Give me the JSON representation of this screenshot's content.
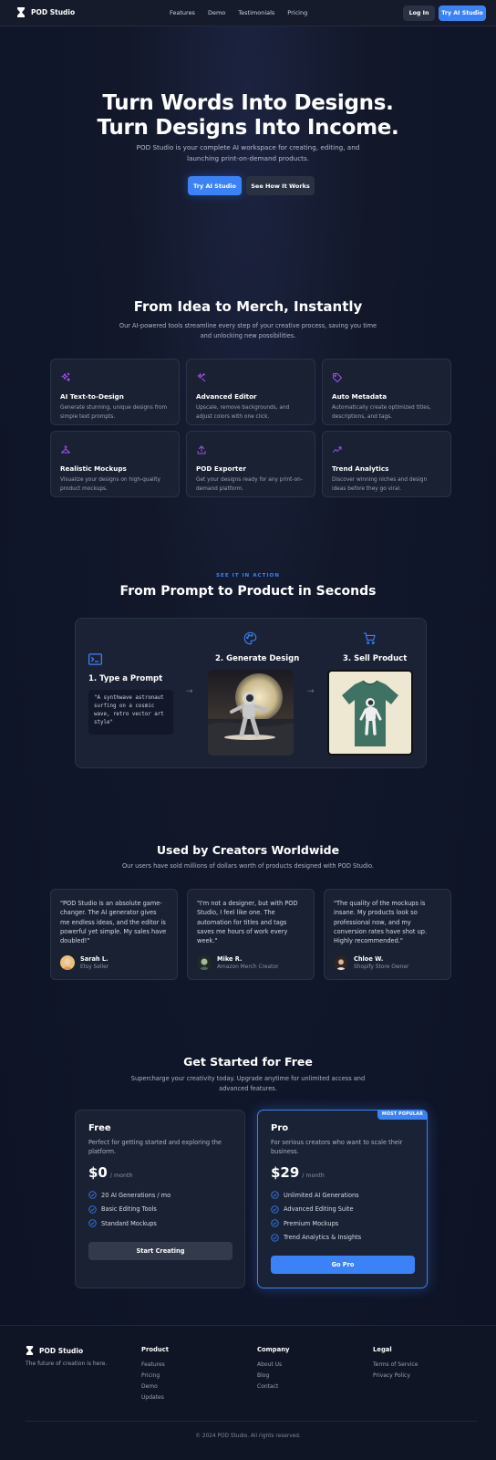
{
  "nav": {
    "brand": "POD Studio",
    "links": [
      "Features",
      "Demo",
      "Testimonials",
      "Pricing"
    ],
    "login": "Log In",
    "cta": "Try AI Studio"
  },
  "hero": {
    "title_line1": "Turn Words Into Designs.",
    "title_line2": "Turn Designs Into Income.",
    "subtitle": "POD Studio is your complete AI workspace for creating, editing, and launching print-on-demand products.",
    "primary_button": "Try AI Studio",
    "secondary_button": "See How It Works"
  },
  "features": {
    "title": "From Idea to Merch, Instantly",
    "subtitle": "Our AI-powered tools streamline every step of your creative process, saving you time and unlocking new possibilities.",
    "items": [
      {
        "icon": "sparkles-icon",
        "title": "AI Text-to-Design",
        "desc": "Generate stunning, unique designs from simple text prompts."
      },
      {
        "icon": "magic-wand-icon",
        "title": "Advanced Editor",
        "desc": "Upscale, remove backgrounds, and adjust colors with one click."
      },
      {
        "icon": "tag-icon",
        "title": "Auto Metadata",
        "desc": "Automatically create optimized titles, descriptions, and tags."
      },
      {
        "icon": "hanger-icon",
        "title": "Realistic Mockups",
        "desc": "Visualize your designs on high-quality product mockups."
      },
      {
        "icon": "upload-icon",
        "title": "POD Exporter",
        "desc": "Get your designs ready for any print-on-demand platform."
      },
      {
        "icon": "trend-chart-icon",
        "title": "Trend Analytics",
        "desc": "Discover winning niches and design ideas before they go viral."
      }
    ]
  },
  "demo": {
    "kicker": "SEE IT IN ACTION",
    "title": "From Prompt to Product in Seconds",
    "step1": "1. Type a Prompt",
    "prompt": "\"A synthwave astronaut surfing on a cosmic wave, retro vector art style\"",
    "step2": "2. Generate Design",
    "step3": "3. Sell Product"
  },
  "testimonials": {
    "title": "Used by Creators Worldwide",
    "subtitle": "Our users have sold millions of dollars worth of products designed with POD Studio.",
    "items": [
      {
        "quote": "\"POD Studio is an absolute game-changer. The AI generator gives me endless ideas, and the editor is powerful yet simple. My sales have doubled!\"",
        "name": "Sarah L.",
        "role": "Etsy Seller"
      },
      {
        "quote": "\"I'm not a designer, but with POD Studio, I feel like one. The automation for titles and tags saves me hours of work every week.\"",
        "name": "Mike R.",
        "role": "Amazon Merch Creator"
      },
      {
        "quote": "\"The quality of the mockups is insane. My products look so professional now, and my conversion rates have shot up. Highly recommended.\"",
        "name": "Chloe W.",
        "role": "Shopify Store Owner"
      }
    ]
  },
  "pricing": {
    "title": "Get Started for Free",
    "subtitle": "Supercharge your creativity today. Upgrade anytime for unlimited access and advanced features.",
    "free": {
      "name": "Free",
      "desc": "Perfect for getting started and exploring the platform.",
      "price": "$0",
      "per": "/ month",
      "features": [
        "20 AI Generations / mo",
        "Basic Editing Tools",
        "Standard Mockups"
      ],
      "button": "Start Creating"
    },
    "pro": {
      "badge": "MOST POPULAR",
      "name": "Pro",
      "desc": "For serious creators who want to scale their business.",
      "price": "$29",
      "per": "/ month",
      "features": [
        "Unlimited AI Generations",
        "Advanced Editing Suite",
        "Premium Mockups",
        "Trend Analytics & Insights"
      ],
      "button": "Go Pro"
    }
  },
  "footer": {
    "brand": "POD Studio",
    "tagline": "The future of creation is here.",
    "product_title": "Product",
    "product_links": [
      "Features",
      "Pricing",
      "Demo",
      "Updates"
    ],
    "company_title": "Company",
    "company_links": [
      "About Us",
      "Blog",
      "Contact"
    ],
    "legal_title": "Legal",
    "legal_links": [
      "Terms of Service",
      "Privacy Policy"
    ],
    "copyright": "© 2024 POD Studio. All rights reserved."
  },
  "colors": {
    "accent": "#3b82f6",
    "icon_purple": "#a855f7",
    "background": "#121829",
    "card": "#1a2133"
  }
}
